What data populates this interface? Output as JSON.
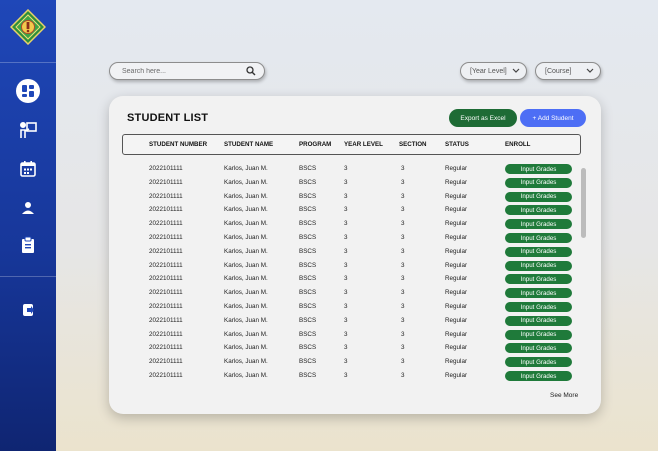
{
  "brand": {
    "logo_icon": "school-crest-logo",
    "colors": {
      "sidebar": "#1f47b8",
      "green": "#1e6b35",
      "blue": "#4d6ef5"
    }
  },
  "sidebar": {
    "items": [
      {
        "name": "dashboard-icon"
      },
      {
        "name": "teacher-icon"
      },
      {
        "name": "calendar-icon"
      },
      {
        "name": "user-icon"
      },
      {
        "name": "clipboard-icon"
      },
      {
        "name": "logout-icon"
      }
    ]
  },
  "search": {
    "placeholder": "Search here..."
  },
  "filters": {
    "year_level": "[Year Level]",
    "course": "[Course]"
  },
  "card": {
    "title": "STUDENT LIST",
    "export_label": "Export as Excel",
    "add_label": "+ Add Student",
    "see_more": "See More"
  },
  "table": {
    "headers": [
      "STUDENT NUMBER",
      "STUDENT NAME",
      "PROGRAM",
      "YEAR LEVEL",
      "SECTION",
      "STATUS",
      "ENROLL"
    ],
    "rows": [
      {
        "number": "2022101111",
        "name": "Karlos, Juan M.",
        "program": "BSCS",
        "year": "3",
        "section": "3",
        "status": "Regular",
        "enroll": "Input Grades"
      },
      {
        "number": "2022101111",
        "name": "Karlos, Juan M.",
        "program": "BSCS",
        "year": "3",
        "section": "3",
        "status": "Regular",
        "enroll": "Input Grades"
      },
      {
        "number": "2022101111",
        "name": "Karlos, Juan M.",
        "program": "BSCS",
        "year": "3",
        "section": "3",
        "status": "Regular",
        "enroll": "Input Grades"
      },
      {
        "number": "2022101111",
        "name": "Karlos, Juan M.",
        "program": "BSCS",
        "year": "3",
        "section": "3",
        "status": "Regular",
        "enroll": "Input Grades"
      },
      {
        "number": "2022101111",
        "name": "Karlos, Juan M.",
        "program": "BSCS",
        "year": "3",
        "section": "3",
        "status": "Regular",
        "enroll": "Input Grades"
      },
      {
        "number": "2022101111",
        "name": "Karlos, Juan M.",
        "program": "BSCS",
        "year": "3",
        "section": "3",
        "status": "Regular",
        "enroll": "Input Grades"
      },
      {
        "number": "2022101111",
        "name": "Karlos, Juan M.",
        "program": "BSCS",
        "year": "3",
        "section": "3",
        "status": "Regular",
        "enroll": "Input Grades"
      },
      {
        "number": "2022101111",
        "name": "Karlos, Juan M.",
        "program": "BSCS",
        "year": "3",
        "section": "3",
        "status": "Regular",
        "enroll": "Input Grades"
      },
      {
        "number": "2022101111",
        "name": "Karlos, Juan M.",
        "program": "BSCS",
        "year": "3",
        "section": "3",
        "status": "Regular",
        "enroll": "Input Grades"
      },
      {
        "number": "2022101111",
        "name": "Karlos, Juan M.",
        "program": "BSCS",
        "year": "3",
        "section": "3",
        "status": "Regular",
        "enroll": "Input Grades"
      },
      {
        "number": "2022101111",
        "name": "Karlos, Juan M.",
        "program": "BSCS",
        "year": "3",
        "section": "3",
        "status": "Regular",
        "enroll": "Input Grades"
      },
      {
        "number": "2022101111",
        "name": "Karlos, Juan M.",
        "program": "BSCS",
        "year": "3",
        "section": "3",
        "status": "Regular",
        "enroll": "Input Grades"
      },
      {
        "number": "2022101111",
        "name": "Karlos, Juan M.",
        "program": "BSCS",
        "year": "3",
        "section": "3",
        "status": "Regular",
        "enroll": "Input Grades"
      },
      {
        "number": "2022101111",
        "name": "Karlos, Juan M.",
        "program": "BSCS",
        "year": "3",
        "section": "3",
        "status": "Regular",
        "enroll": "Input Grades"
      },
      {
        "number": "2022101111",
        "name": "Karlos, Juan M.",
        "program": "BSCS",
        "year": "3",
        "section": "3",
        "status": "Regular",
        "enroll": "Input Grades"
      },
      {
        "number": "2022101111",
        "name": "Karlos, Juan M.",
        "program": "BSCS",
        "year": "3",
        "section": "3",
        "status": "Regular",
        "enroll": "Input Grades"
      }
    ]
  }
}
